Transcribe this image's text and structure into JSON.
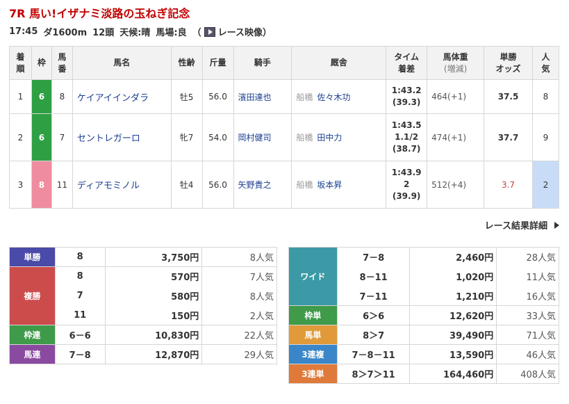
{
  "race": {
    "title": "7R 馬い!イザナミ淡路の玉ねぎ記念",
    "time": "17:45",
    "course": "ダ1600m",
    "heads": "12頭",
    "weather": "天候:晴",
    "track": "馬場:良",
    "video_label": "レース映像"
  },
  "headers": {
    "rank": [
      "着",
      "順"
    ],
    "waku": "枠",
    "num": [
      "馬",
      "番"
    ],
    "horse": "馬名",
    "sexage": "性齢",
    "kinryo": "斤量",
    "jockey": "騎手",
    "stable": "厩舎",
    "time": [
      "タイム",
      "着差"
    ],
    "weight": [
      "馬体重",
      "(増減)"
    ],
    "odds": [
      "単勝",
      "オッズ"
    ],
    "pop": [
      "人",
      "気"
    ]
  },
  "results": [
    {
      "rank": "1",
      "waku": "6",
      "waku_color": "#2ea043",
      "num": "8",
      "horse": "ケイアイインダラ",
      "sexage": "牡5",
      "kinryo": "56.0",
      "jockey": "濱田達也",
      "stable_loc": "船橋",
      "trainer": "佐々木功",
      "time": "1:43.2",
      "margin": "",
      "last3f": "(39.3)",
      "weight": "464(+1)",
      "odds": "37.5",
      "pop": "8"
    },
    {
      "rank": "2",
      "waku": "6",
      "waku_color": "#2ea043",
      "num": "7",
      "horse": "セントレガーロ",
      "sexage": "牝7",
      "kinryo": "54.0",
      "jockey": "岡村健司",
      "stable_loc": "船橋",
      "trainer": "田中力",
      "time": "1:43.5",
      "margin": "1.1/2",
      "last3f": "(38.7)",
      "weight": "474(+1)",
      "odds": "37.7",
      "pop": "9"
    },
    {
      "rank": "3",
      "waku": "8",
      "waku_color": "#f08ca0",
      "num": "11",
      "horse": "ディアモミノル",
      "sexage": "牡4",
      "kinryo": "56.0",
      "jockey": "矢野貴之",
      "stable_loc": "船橋",
      "trainer": "坂本昇",
      "time": "1:43.9",
      "margin": "2",
      "last3f": "(39.9)",
      "weight": "512(+4)",
      "odds": "3.7",
      "pop": "2"
    }
  ],
  "detail_link": "レース結果詳細",
  "payouts_left": {
    "tansho": {
      "label": "単勝",
      "color": "#4a4aa8",
      "rows": [
        {
          "comb": "8",
          "yen": "3,750円",
          "pop": "8人気"
        }
      ]
    },
    "fukusho": {
      "label": "複勝",
      "color": "#cc4c4c",
      "rows": [
        {
          "comb": "8",
          "yen": "570円",
          "pop": "7人気"
        },
        {
          "comb": "7",
          "yen": "580円",
          "pop": "8人気"
        },
        {
          "comb": "11",
          "yen": "150円",
          "pop": "2人気"
        }
      ]
    },
    "wakuren": {
      "label": "枠連",
      "color": "#3f9a4a",
      "rows": [
        {
          "comb": "6－6",
          "yen": "10,830円",
          "pop": "22人気"
        }
      ]
    },
    "umaren": {
      "label": "馬連",
      "color": "#8a4aa0",
      "rows": [
        {
          "comb": "7－8",
          "yen": "12,870円",
          "pop": "29人気"
        }
      ]
    }
  },
  "payouts_right": {
    "wide": {
      "label": "ワイド",
      "color": "#3b9aa6",
      "rows": [
        {
          "comb": "7－8",
          "yen": "2,460円",
          "pop": "28人気"
        },
        {
          "comb": "8－11",
          "yen": "1,020円",
          "pop": "11人気"
        },
        {
          "comb": "7－11",
          "yen": "1,210円",
          "pop": "16人気"
        }
      ]
    },
    "wakutan": {
      "label": "枠単",
      "color": "#3f9a4a",
      "rows": [
        {
          "comb": "6＞6",
          "yen": "12,620円",
          "pop": "33人気"
        }
      ]
    },
    "umatan": {
      "label": "馬単",
      "color": "#e09a3a",
      "rows": [
        {
          "comb": "8＞7",
          "yen": "39,490円",
          "pop": "71人気"
        }
      ]
    },
    "sanrenpuku": {
      "label": "3連複",
      "color": "#3a86c8",
      "rows": [
        {
          "comb": "7－8－11",
          "yen": "13,590円",
          "pop": "46人気"
        }
      ]
    },
    "sanrentan": {
      "label": "3連単",
      "color": "#e07a3a",
      "rows": [
        {
          "comb": "8＞7＞11",
          "yen": "164,460円",
          "pop": "408人気"
        }
      ]
    }
  }
}
